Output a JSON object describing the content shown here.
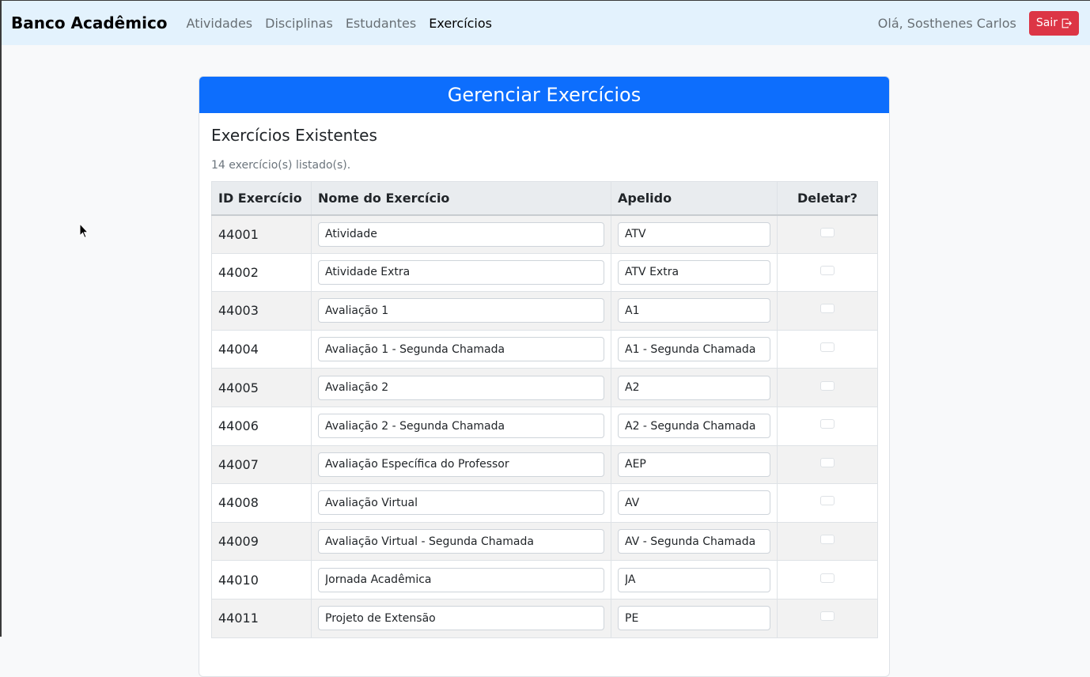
{
  "navbar": {
    "brand": "Banco Acadêmico",
    "links": [
      {
        "label": "Atividades"
      },
      {
        "label": "Disciplinas"
      },
      {
        "label": "Estudantes"
      },
      {
        "label": "Exercícios"
      }
    ],
    "greeting": "Olá, Sosthenes Carlos",
    "logout_label": "Sair",
    "logout_icon": "box-arrow-right-icon"
  },
  "card": {
    "header": "Gerenciar Exercícios",
    "section_title": "Exercícios Existentes",
    "count_text": "14 exercício(s) listado(s).",
    "columns": [
      "ID Exercício",
      "Nome do Exercício",
      "Apelido",
      "Deletar?"
    ],
    "rows": [
      {
        "id": "44001",
        "name": "Atividade",
        "nickname": "ATV"
      },
      {
        "id": "44002",
        "name": "Atividade Extra",
        "nickname": "ATV Extra"
      },
      {
        "id": "44003",
        "name": "Avaliação 1",
        "nickname": "A1"
      },
      {
        "id": "44004",
        "name": "Avaliação 1 - Segunda Chamada",
        "nickname": "A1 - Segunda Chamada"
      },
      {
        "id": "44005",
        "name": "Avaliação 2",
        "nickname": "A2"
      },
      {
        "id": "44006",
        "name": "Avaliação 2 - Segunda Chamada",
        "nickname": "A2 - Segunda Chamada"
      },
      {
        "id": "44007",
        "name": "Avaliação Específica do Professor",
        "nickname": "AEP"
      },
      {
        "id": "44008",
        "name": "Avaliação Virtual",
        "nickname": "AV"
      },
      {
        "id": "44009",
        "name": "Avaliação Virtual - Segunda Chamada",
        "nickname": "AV - Segunda Chamada"
      },
      {
        "id": "44010",
        "name": "Jornada Acadêmica",
        "nickname": "JA"
      },
      {
        "id": "44011",
        "name": "Projeto de Extensão",
        "nickname": "PE"
      }
    ]
  },
  "colors": {
    "navbar_bg": "#e3f2fd",
    "header_bg": "#0d6efd",
    "logout_bg": "#dc3545"
  }
}
